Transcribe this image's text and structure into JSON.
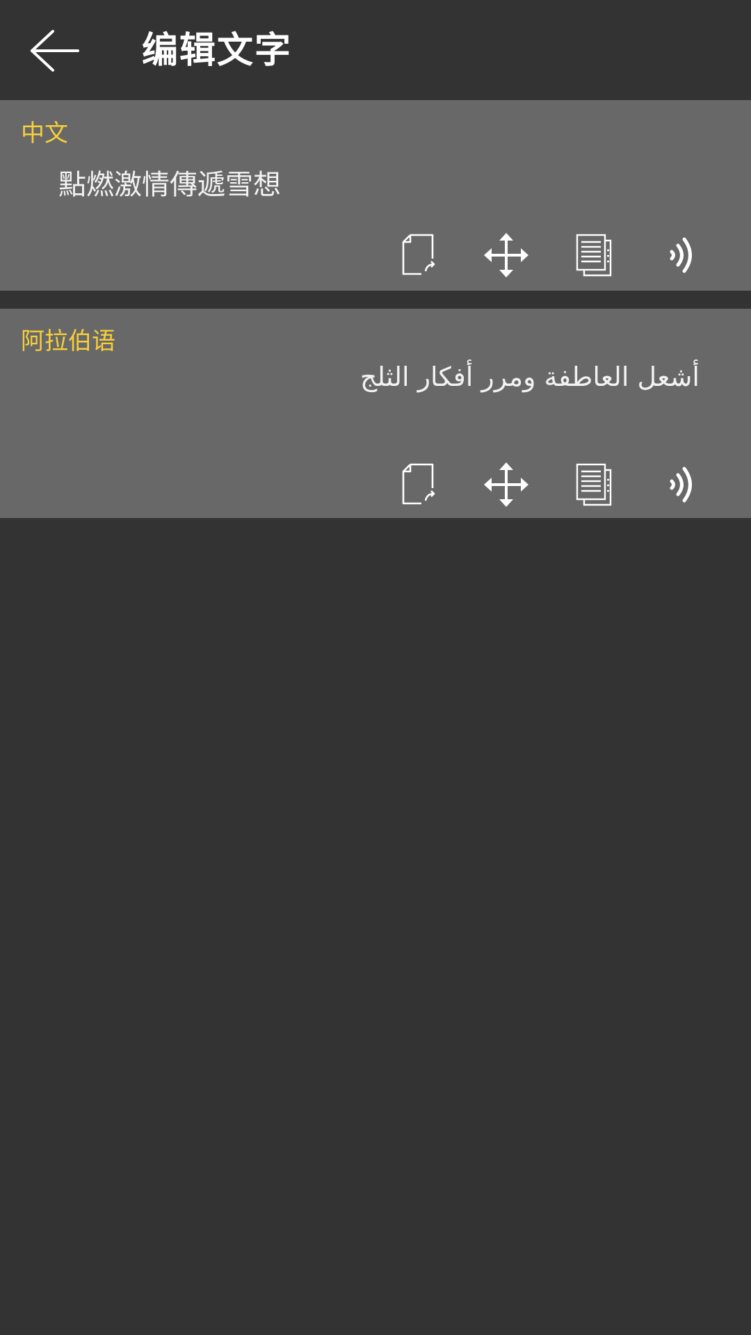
{
  "header": {
    "title": "编辑文字",
    "back_icon": "back-arrow-icon"
  },
  "cards": [
    {
      "language": "中文",
      "text": "點燃激情傳遞雪想",
      "actions": [
        "export-icon",
        "move-icon",
        "copy-icon",
        "speaker-icon"
      ]
    },
    {
      "language": "阿拉伯语",
      "text": "أشعل العاطفة ومرر أفكار الثلج",
      "actions": [
        "export-icon",
        "move-icon",
        "copy-icon",
        "speaker-icon"
      ]
    }
  ],
  "colors": {
    "background": "#333333",
    "card": "#686868",
    "label": "#f7cf3a",
    "text": "#f2f2f2"
  }
}
